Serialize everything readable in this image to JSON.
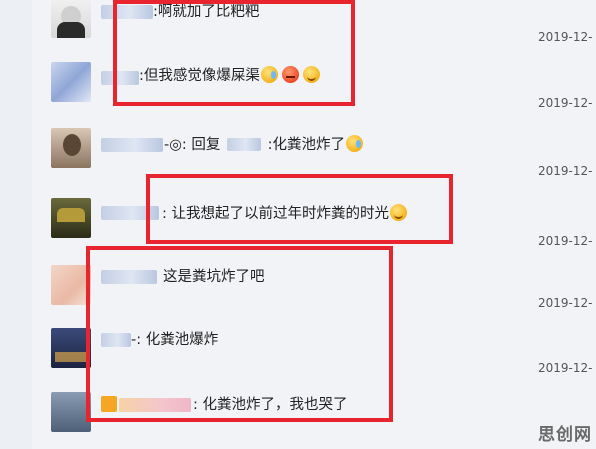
{
  "comments": [
    {
      "text": ":啊就加了比粑粑",
      "date": "2019-12-"
    },
    {
      "text": ":但我感觉像爆屎渠",
      "date": "2019-12-"
    },
    {
      "text": "-◎: 回复",
      "reply_text": ":化粪池炸了",
      "date": "2019-12-"
    },
    {
      "text": ": 让我想起了以前过年时炸粪的时光",
      "date": "2019-12-"
    },
    {
      "text": "这是粪坑炸了吧",
      "date": "2019-12-"
    },
    {
      "text": "-: 化粪池爆炸",
      "date": "2019-12-"
    },
    {
      "text": ": 化粪池炸了，我也哭了",
      "date": ""
    }
  ],
  "emojis": {
    "row2": [
      "happy-cry",
      "angry",
      "happy"
    ],
    "row3": [
      "happy-cry"
    ],
    "row4": [
      "happy"
    ]
  },
  "watermark": "思创网",
  "colors": {
    "highlight_box": "#e8242e",
    "panel_bg": "#f1f3f7"
  }
}
